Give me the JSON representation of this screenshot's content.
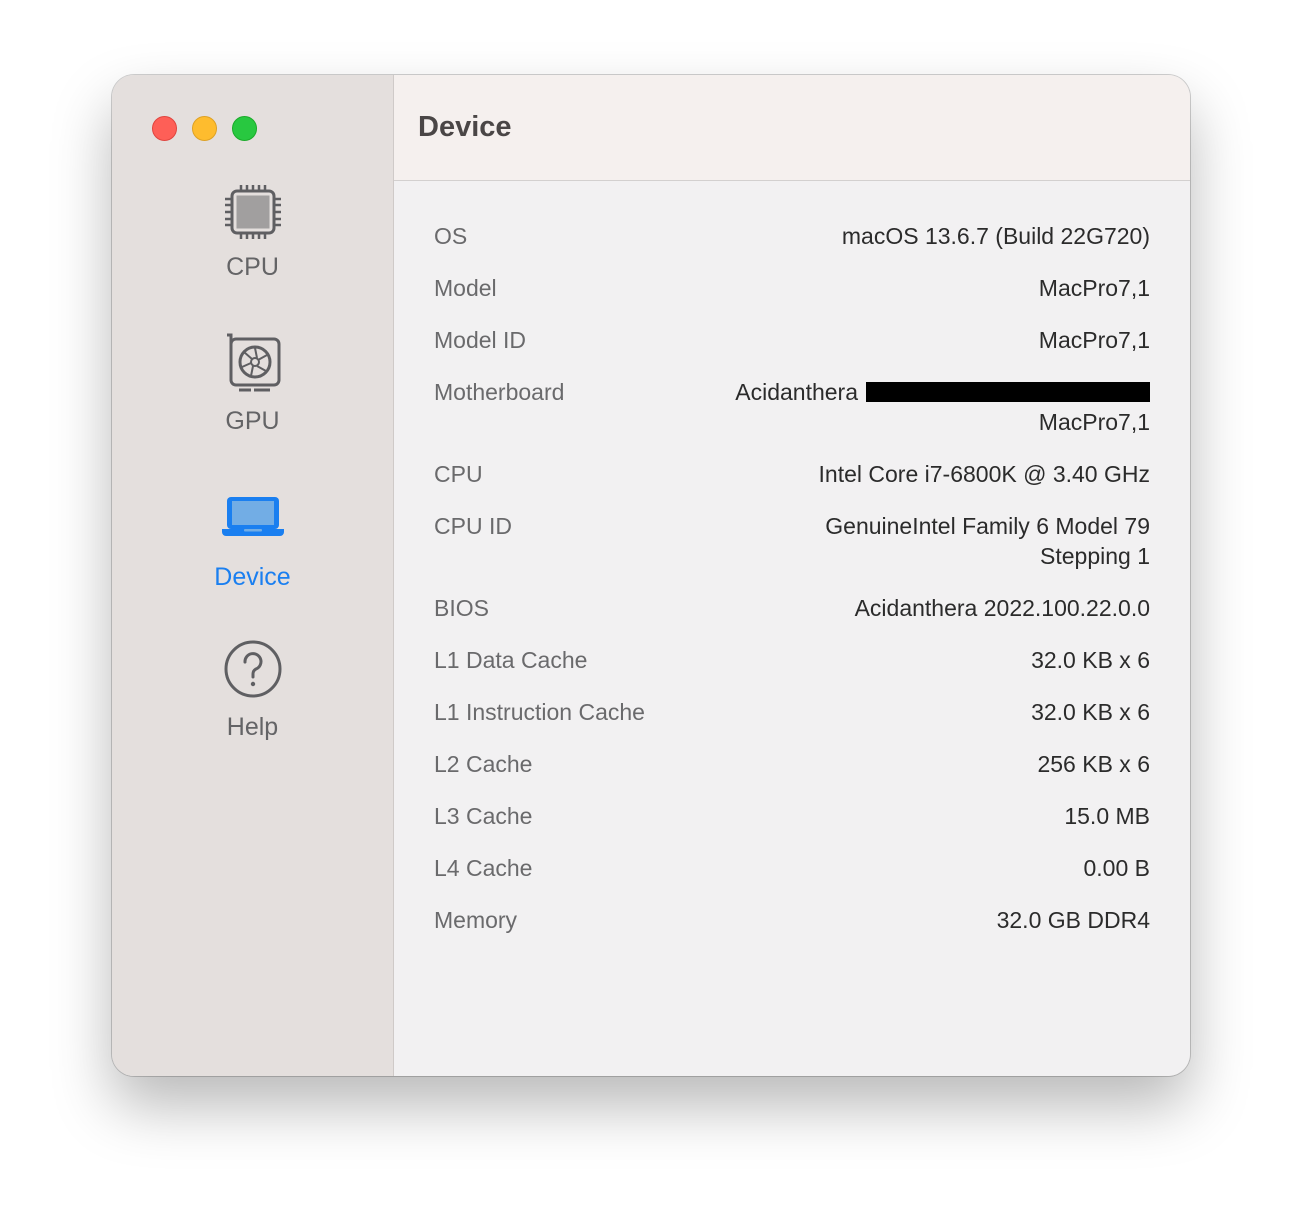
{
  "window": {
    "title": "Device"
  },
  "sidebar": {
    "items": [
      {
        "label": "CPU",
        "icon": "cpu-chip-icon"
      },
      {
        "label": "GPU",
        "icon": "gpu-card-icon"
      },
      {
        "label": "Device",
        "icon": "laptop-icon",
        "active": true
      },
      {
        "label": "Help",
        "icon": "question-circle-icon"
      }
    ]
  },
  "accent": "#1a7ff0",
  "rows": [
    {
      "label": "OS",
      "value": "macOS 13.6.7 (Build 22G720)"
    },
    {
      "label": "Model",
      "value": "MacPro7,1"
    },
    {
      "label": "Model ID",
      "value": "MacPro7,1"
    },
    {
      "label": "Motherboard",
      "value": "Acidanthera",
      "value2": "MacPro7,1"
    },
    {
      "label": "CPU",
      "value": "Intel Core i7-6800K @ 3.40 GHz"
    },
    {
      "label": "CPU ID",
      "value": "GenuineIntel Family 6 Model 79",
      "value2": "Stepping 1"
    },
    {
      "label": "BIOS",
      "value": "Acidanthera 2022.100.22.0.0"
    },
    {
      "label": "L1 Data Cache",
      "value": "32.0 KB x 6"
    },
    {
      "label": "L1 Instruction Cache",
      "value": "32.0 KB x 6"
    },
    {
      "label": "L2 Cache",
      "value": "256 KB x 6"
    },
    {
      "label": "L3 Cache",
      "value": "15.0 MB"
    },
    {
      "label": "L4 Cache",
      "value": "0.00 B"
    },
    {
      "label": "Memory",
      "value": "32.0 GB DDR4"
    }
  ]
}
